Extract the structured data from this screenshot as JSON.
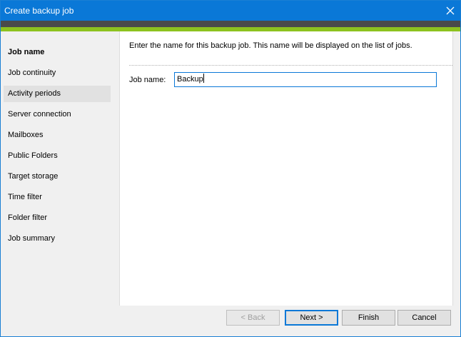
{
  "window": {
    "title": "Create backup job",
    "colors": {
      "titlebar": "#0a78d7",
      "band_dark": "#4a4a4a",
      "band_green": "#8dc21f"
    }
  },
  "sidebar": {
    "items": [
      {
        "label": "Job name",
        "state": "active"
      },
      {
        "label": "Job continuity",
        "state": "normal"
      },
      {
        "label": "Activity periods",
        "state": "hover"
      },
      {
        "label": "Server connection",
        "state": "normal"
      },
      {
        "label": "Mailboxes",
        "state": "normal"
      },
      {
        "label": "Public Folders",
        "state": "normal"
      },
      {
        "label": "Target storage",
        "state": "normal"
      },
      {
        "label": "Time filter",
        "state": "normal"
      },
      {
        "label": "Folder filter",
        "state": "normal"
      },
      {
        "label": "Job summary",
        "state": "normal"
      }
    ]
  },
  "main": {
    "instruction": "Enter the name for this backup job. This name will be displayed on the list of jobs.",
    "job_name_label": "Job name:",
    "job_name_value": "Backup"
  },
  "footer": {
    "back_label": "< Back",
    "next_label": "Next >",
    "finish_label": "Finish",
    "cancel_label": "Cancel"
  },
  "icons": {
    "close": "close-icon"
  }
}
